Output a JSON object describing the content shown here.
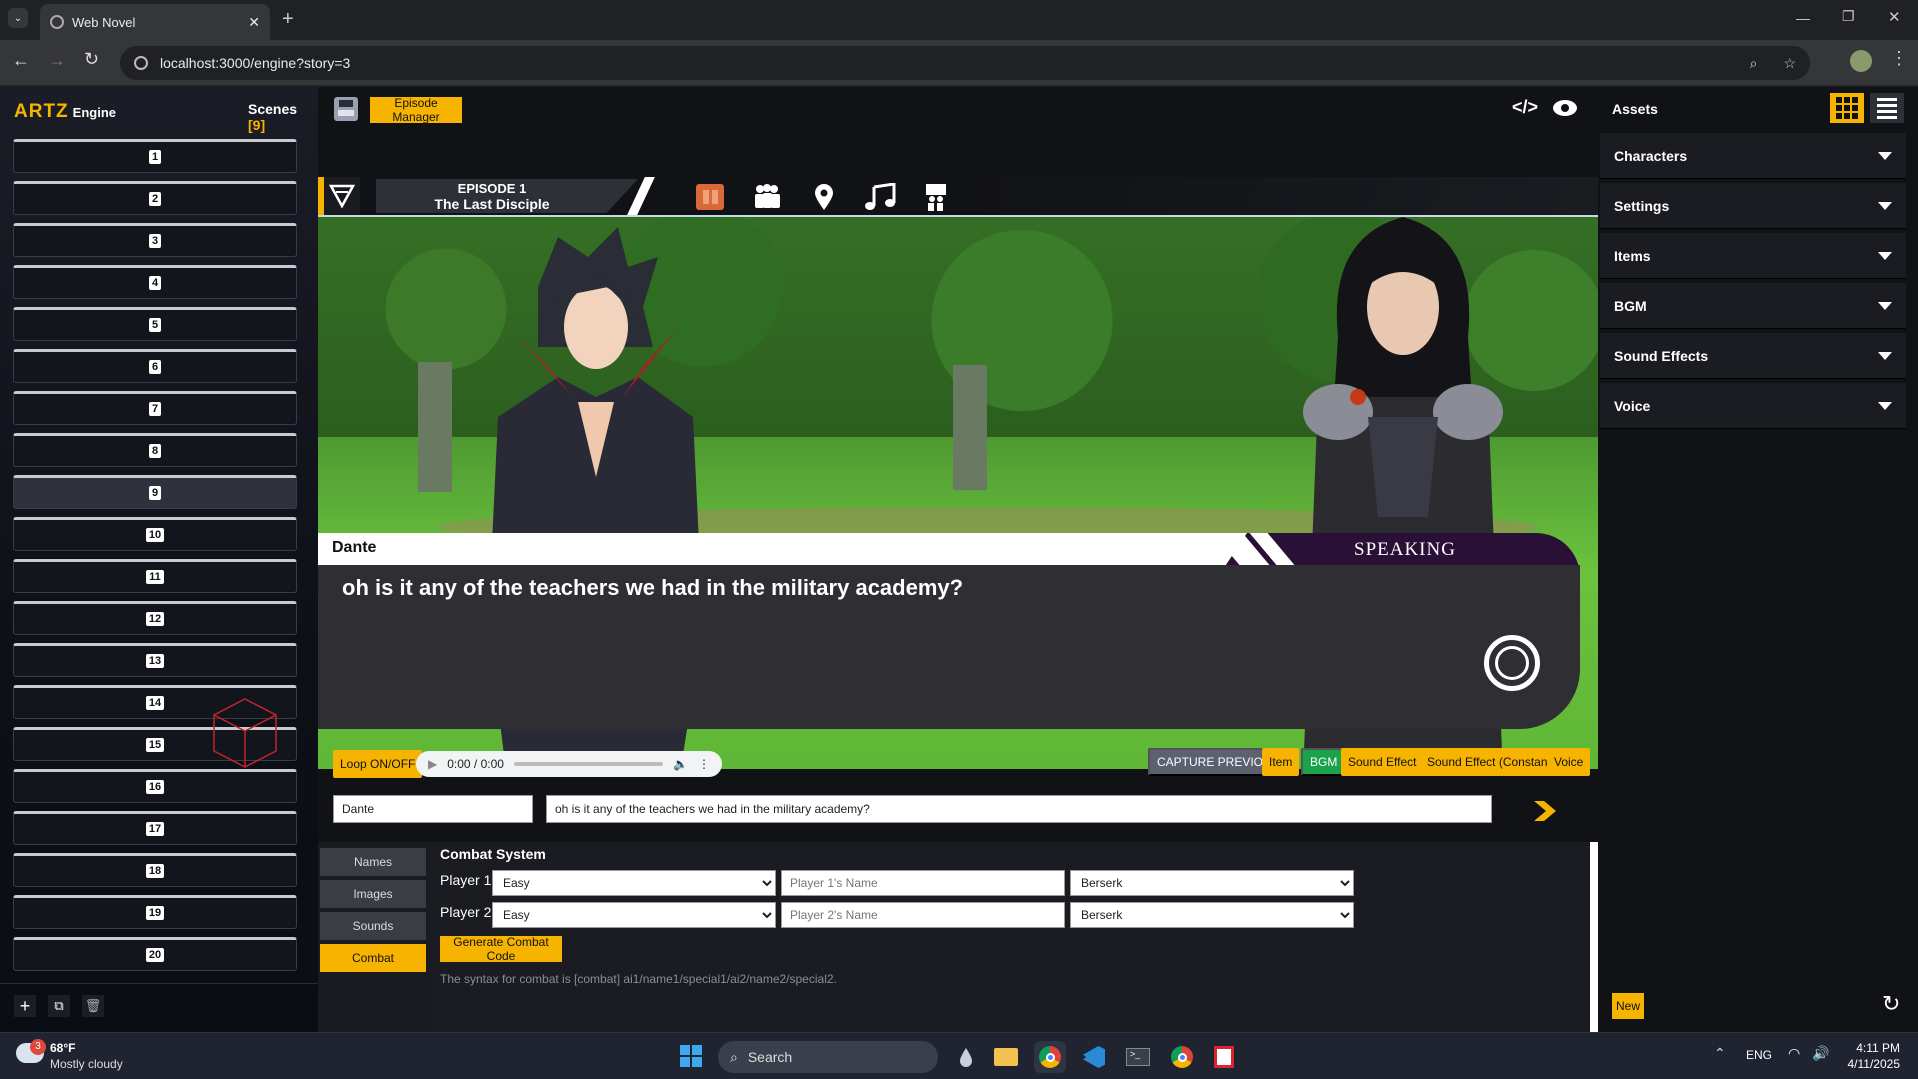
{
  "browser": {
    "tab_title": "Web Novel",
    "url": "localhost:3000/engine?story=3"
  },
  "app": {
    "logo": "ARTZ",
    "logo_sub": "Engine",
    "scenes_label": "Scenes",
    "scenes_count": "[9]",
    "scenes": [
      "1",
      "2",
      "3",
      "4",
      "5",
      "6",
      "7",
      "8",
      "9",
      "10",
      "11",
      "12",
      "13",
      "14",
      "15",
      "16",
      "17",
      "18",
      "19",
      "20"
    ],
    "active_scene": "9",
    "episode_manager_label": "Episode Manager",
    "episode": {
      "number": "EPISODE 1",
      "title": "The Last Disciple"
    },
    "dialogue": {
      "speaker": "Dante",
      "status": "SPEAKING",
      "text": "oh is it any of the teachers we had in the military academy?"
    },
    "toolbar": {
      "loop": "Loop ON/OFF",
      "audio_time": "0:00 / 0:00",
      "capture": "CAPTURE PREVIOUS",
      "item": "Item",
      "bgm": "BGM",
      "sound_effect": "Sound Effect",
      "sound_effect_constant": "Sound Effect (Constant)",
      "voice": "Voice"
    },
    "editor": {
      "name_value": "Dante",
      "text_value": "oh is it any of the teachers we had in the military academy?"
    },
    "side_tabs": [
      "Names",
      "Images",
      "Sounds",
      "Combat"
    ],
    "combat": {
      "title": "Combat System",
      "p1_label": "Player 1",
      "p2_label": "Player 2",
      "p1_difficulty": "Easy",
      "p2_difficulty": "Easy",
      "p1_placeholder": "Player 1's Name",
      "p2_placeholder": "Player 2's Name",
      "p1_special": "Berserk",
      "p2_special": "Berserk",
      "generate_label": "Generate Combat Code",
      "syntax": "The syntax for combat is [combat] ai1/name1/special1/ai2/name2/special2."
    },
    "assets": {
      "title": "Assets",
      "sections": [
        "Characters",
        "Settings",
        "Items",
        "BGM",
        "Sound Effects",
        "Voice"
      ],
      "new_label": "New"
    },
    "colors": {
      "accent": "#f6b400",
      "bgm_green": "#1aa34a",
      "capture_gray": "#5c6170",
      "speaking_purple": "#2a1036"
    }
  },
  "taskbar": {
    "weather_temp": "68°F",
    "weather_desc": "Mostly cloudy",
    "weather_badge": "3",
    "search": "Search",
    "lang": "ENG",
    "time": "4:11 PM",
    "date": "4/11/2025"
  }
}
